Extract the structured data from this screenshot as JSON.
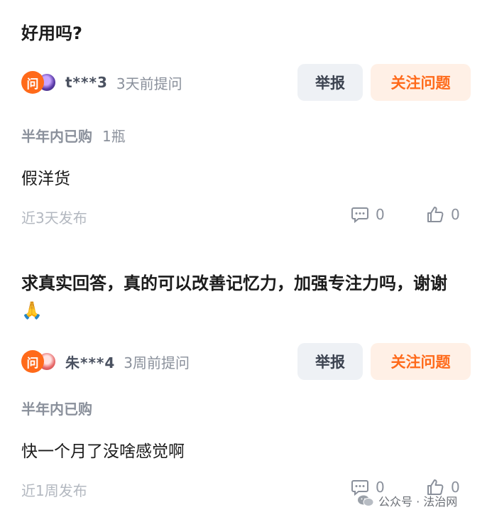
{
  "questions": [
    {
      "text": "好用吗?",
      "badge": "问",
      "username": "t***3",
      "asked_time": "3天前提问",
      "report_label": "举报",
      "follow_label": "关注问题",
      "purchase_label": "半年内已购",
      "purchase_qty": "1瓶",
      "answer": "假洋货",
      "post_time": "近3天发布",
      "comments": "0",
      "likes": "0"
    },
    {
      "text": "求真实回答，真的可以改善记忆力，加强专注力吗，谢谢🙏",
      "badge": "问",
      "username": "朱***4",
      "asked_time": "3周前提问",
      "report_label": "举报",
      "follow_label": "关注问题",
      "purchase_label": "半年内已购",
      "purchase_qty": "",
      "answer": "快一个月了没啥感觉啊",
      "post_time": "近1周发布",
      "comments": "0",
      "likes": "0"
    }
  ],
  "watermark": {
    "text": "公众号 · 法治网",
    "icon": "wechat-icon"
  },
  "colors": {
    "accent": "#ff6a1a",
    "follow_bg": "#fff0e6",
    "report_bg": "#eef1f5"
  }
}
